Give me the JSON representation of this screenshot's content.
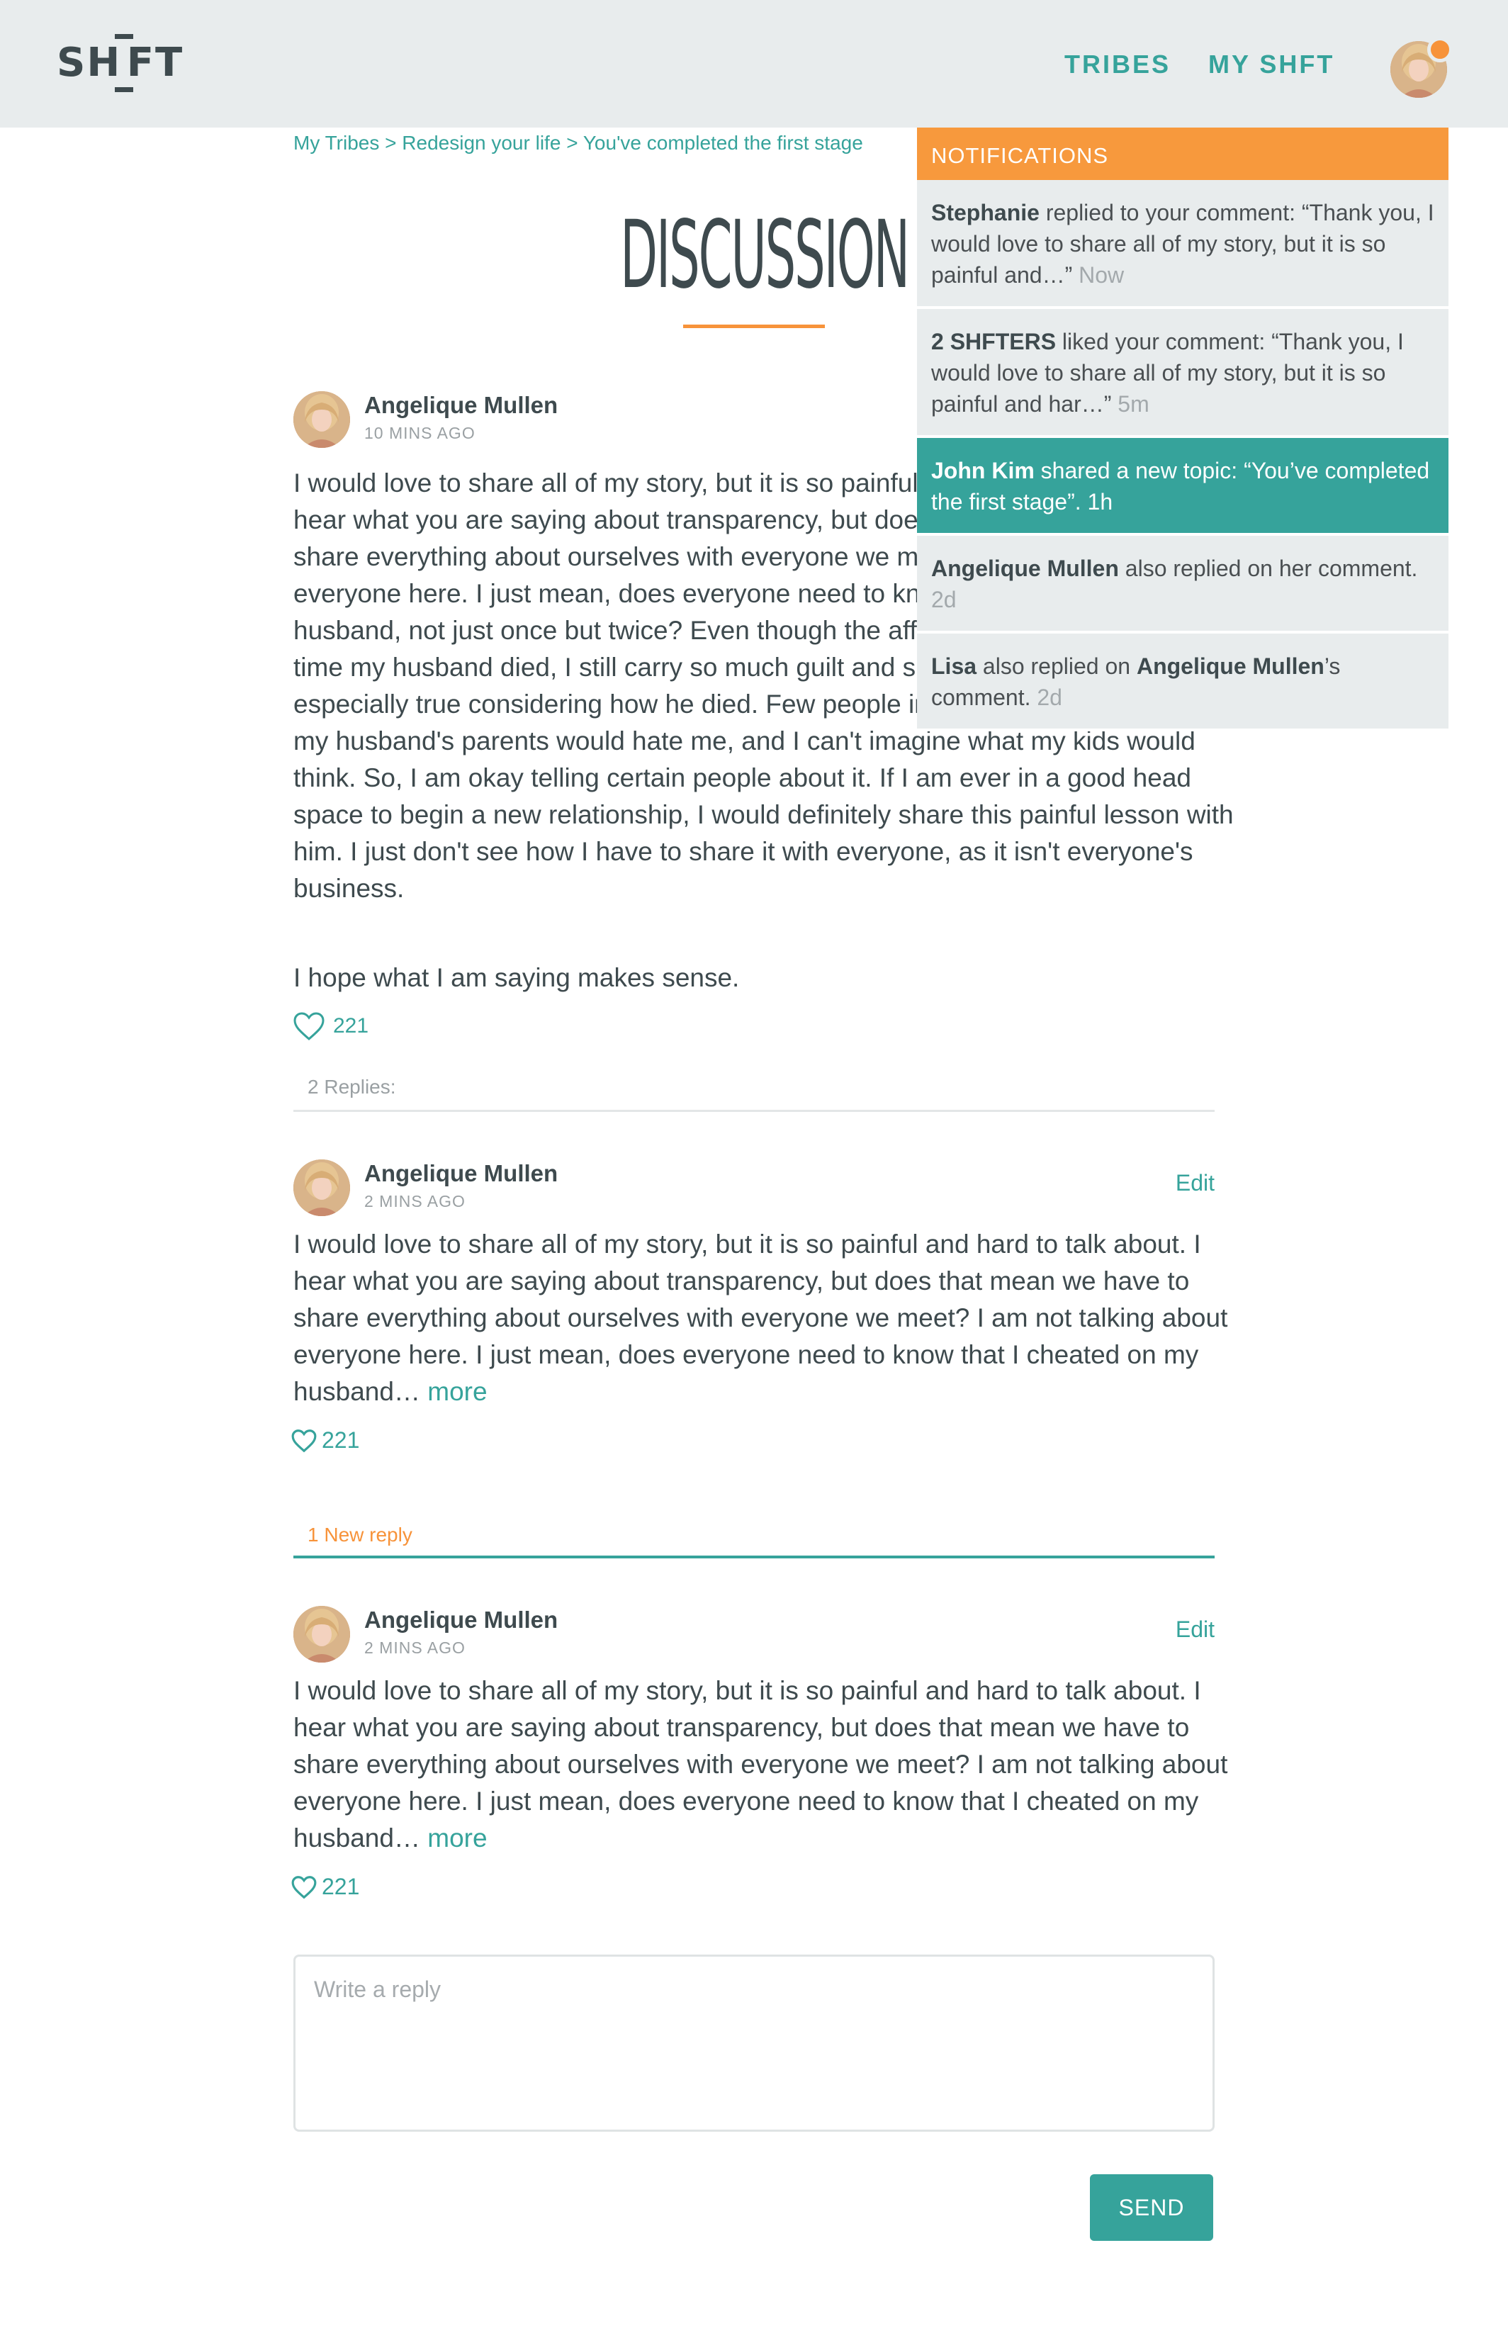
{
  "header": {
    "logo": "SHFT",
    "nav": {
      "tribes": "TRIBES",
      "my_shft": "MY SHFT"
    }
  },
  "breadcrumb": {
    "items": [
      "My Tribes",
      "Redesign your life",
      "You've completed the first stage"
    ],
    "separator": ">"
  },
  "page": {
    "title": "DISCUSSION"
  },
  "main_post": {
    "author": "Angelique Mullen",
    "time": "10 MINS AGO",
    "paragraph1": "I would love to share all of my story, but it is so painful and hard to talk about. I hear what you are saying about transparency, but does that mean we have to share everything about ourselves with everyone we meet? I am not talking about everyone here. I just mean, does everyone need to know that I cheated on my husband, not just once but twice? Even though the affairs were long over by the time my husband died, I still carry so much guilt and shame about it. This is especially true considering how he died. Few people in my life know. I am sure my husband's parents would hate me, and I can't imagine what my kids would think. So, I am okay telling certain people about it. If I am ever in a good head space to begin a new relationship, I would definitely share this painful lesson with him. I just don't see how I have to share it with everyone, as it isn't everyone's business.",
    "paragraph2": "I hope what I am saying makes sense.",
    "likes": "221"
  },
  "replies_label": "2 Replies:",
  "new_reply_label": "1 New reply",
  "replies": [
    {
      "author": "Angelique Mullen",
      "time": "2 MINS AGO",
      "edit": "Edit",
      "text": "I would love to share all of my story, but it is so painful and hard to talk about. I hear what you are saying about transparency, but does that mean we have to share everything about ourselves with everyone we meet? I am not talking about everyone here. I just mean, does everyone need to know that I cheated on my husband…",
      "more": "more",
      "likes": "221"
    },
    {
      "author": "Angelique Mullen",
      "time": "2 MINS AGO",
      "edit": "Edit",
      "text": "I would love to share all of my story, but it is so painful and hard to talk about. I hear what you are saying about transparency, but does that mean we have to share everything about ourselves with everyone we meet? I am not talking about everyone here. I just mean, does everyone need to know that I cheated on my husband…",
      "more": "more",
      "likes": "221"
    }
  ],
  "reply_form": {
    "placeholder": "Write a reply",
    "send": "SEND"
  },
  "notifications": {
    "title": "NOTIFICATIONS",
    "items": [
      {
        "actor": "Stephanie",
        "text": " replied to your comment: “Thank you, I would love to share all of my story, but it is so painful and…” ",
        "ago": "Now"
      },
      {
        "actor": "2 SHFTERS",
        "text": " liked your comment: “Thank you, I would love to share all of my story, but it is so painful and har…” ",
        "ago": "5m"
      },
      {
        "actor": "John Kim",
        "text": " shared a new topic: “You’ve completed the first stage”. ",
        "ago": "1h"
      },
      {
        "actor": "Angelique Mullen",
        "text": " also replied on her comment. ",
        "ago": "2d"
      },
      {
        "actor_pre": "Lisa",
        "text_pre": " also replied on ",
        "actor": "Angelique Mullen",
        "text": "’s comment. ",
        "ago": "2d"
      }
    ]
  },
  "colors": {
    "accent": "#36a39b",
    "orange": "#f7933a",
    "header_bg": "#e8eced",
    "text_dark": "#3e4a4e"
  },
  "icons": [
    "heart-icon",
    "avatar",
    "notification-dot"
  ]
}
